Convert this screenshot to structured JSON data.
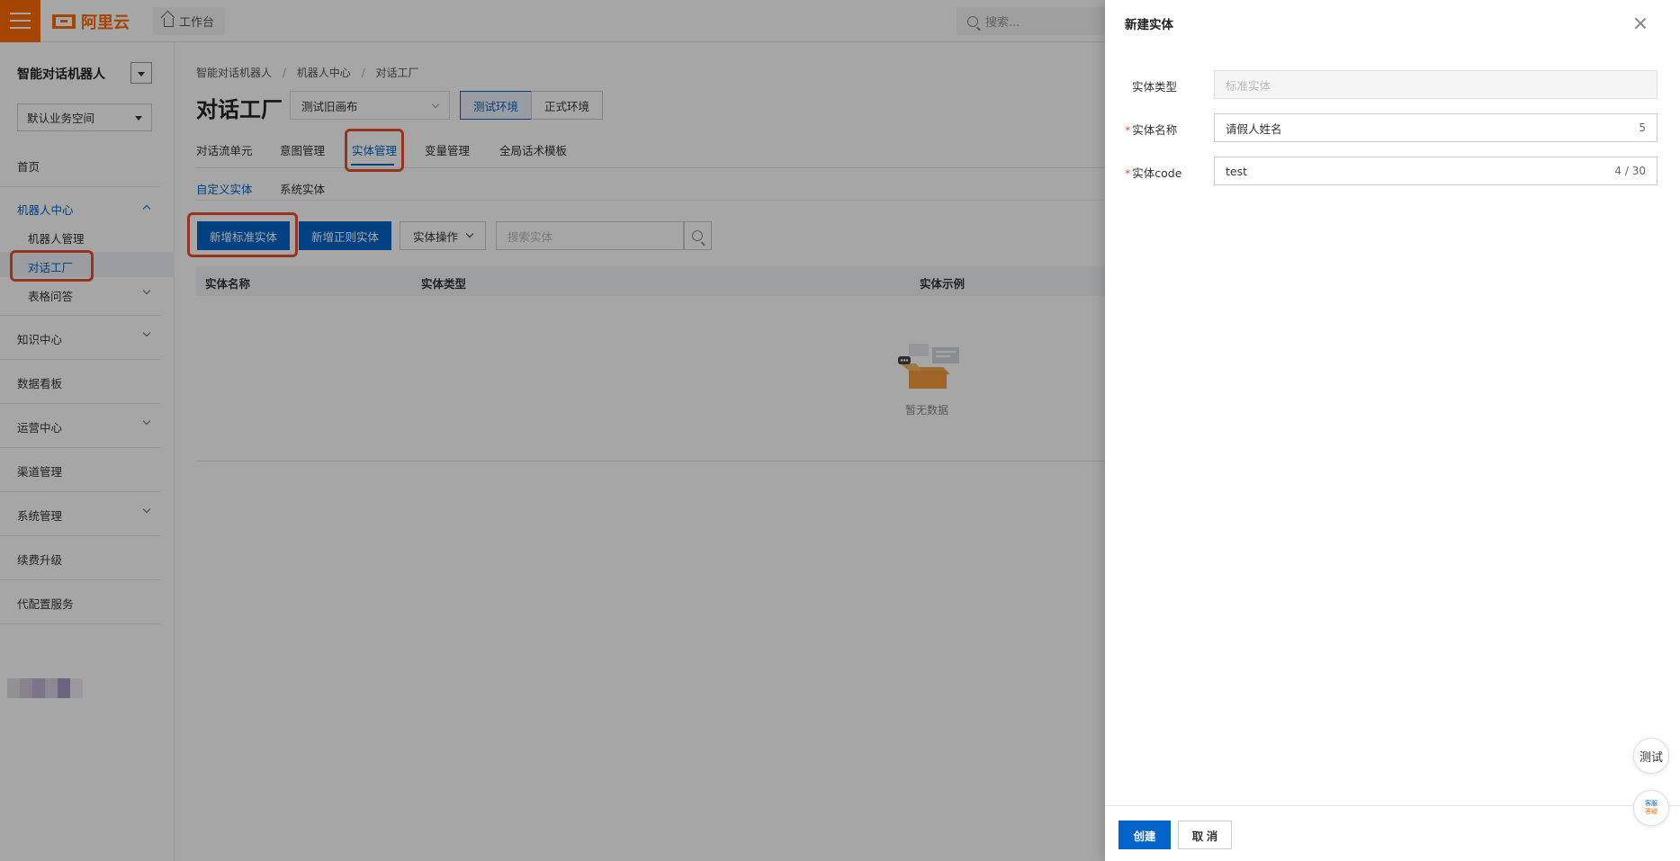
{
  "topbar": {
    "logo_text": "阿里云",
    "workbench_label": "工作台",
    "search_placeholder": "搜索..."
  },
  "sidebar": {
    "title": "智能对话机器人",
    "workspace": "默认业务空间",
    "home": "首页",
    "robot_center": "机器人中心",
    "robot_manage": "机器人管理",
    "dialog_factory": "对话工厂",
    "table_qa": "表格问答",
    "knowledge_center": "知识中心",
    "data_board": "数据看板",
    "ops_center": "运营中心",
    "channel_manage": "渠道管理",
    "system_manage": "系统管理",
    "renew_upgrade": "续费升级",
    "config_service": "代配置服务"
  },
  "main": {
    "breadcrumb": [
      "智能对话机器人",
      "机器人中心",
      "对话工厂"
    ],
    "title": "对话工厂",
    "canvas_select": "测试旧画布",
    "env_test": "测试环境",
    "env_prod": "正式环境",
    "tabs": [
      "对话流单元",
      "意图管理",
      "实体管理",
      "变量管理",
      "全局话术模板"
    ],
    "subtabs": [
      "自定义实体",
      "系统实体"
    ],
    "btn_add_standard": "新增标准实体",
    "btn_add_regex": "新增正则实体",
    "btn_entity_ops": "实体操作",
    "entity_search_placeholder": "搜索实体",
    "table_headers": [
      "实体名称",
      "实体类型",
      "实体示例"
    ],
    "empty_text": "暂无数据"
  },
  "drawer": {
    "title": "新建实体",
    "type_label": "实体类型",
    "type_value": "标准实体",
    "name_label": "实体名称",
    "name_value": "请假人姓名",
    "name_count": "5",
    "code_label": "实体code",
    "code_value": "test",
    "code_count": "4 / 30",
    "create_btn": "创建",
    "cancel_btn": "取 消"
  },
  "floating": {
    "test_label": "测试",
    "service_line1": "客服",
    "service_line2": "答疑"
  },
  "colors": {
    "brand": "#ff6a00",
    "primary": "#0064c8",
    "highlight": "#e8502e"
  }
}
